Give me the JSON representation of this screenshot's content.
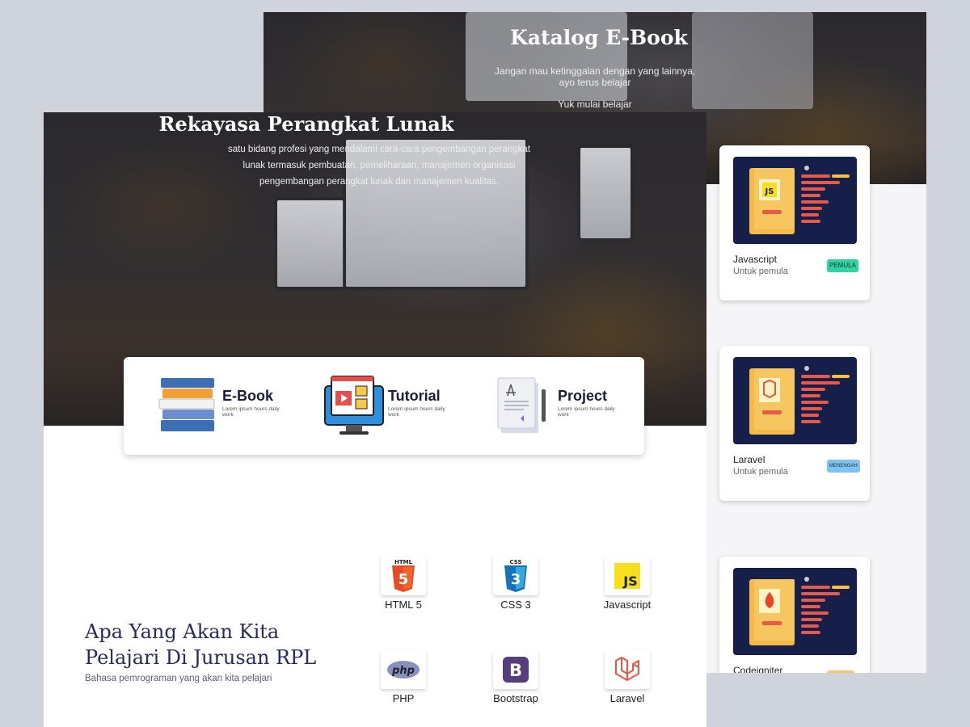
{
  "catalog": {
    "title": "Katalog E-Book",
    "subtitle_line1": "Jangan mau ketinggalan dengan yang lainnya,",
    "subtitle_line2": "ayo terus belajar",
    "cta": "Yuk mulai belajar",
    "books": [
      {
        "name": "Javascript",
        "desc": "Untuk pemula",
        "badge": "PEMULA",
        "badge_color": "#2fd3a6",
        "icon": "javascript-icon"
      },
      {
        "name": "Laravel",
        "desc": "Untuk pemula",
        "badge": "MENENGAH",
        "badge_color": "#7fc3f5",
        "icon": "laravel-icon"
      },
      {
        "name": "Codeigniter",
        "desc": "",
        "badge": "",
        "badge_color": "#f9c46b",
        "icon": "codeigniter-icon"
      }
    ]
  },
  "hero": {
    "title": "Rekayasa Perangkat Lunak",
    "description": "satu bidang profesi yang mendalami cara-cara pengembangan perangkat lunak termasuk pembuatan, pemeliharaan, manajemen organisasi pengembangan perangkat lunak dan manajemen kualitas."
  },
  "features": [
    {
      "title": "E-Book",
      "sub": "Lorem ipsum hours daily work",
      "icon": "books-icon"
    },
    {
      "title": "Tutorial",
      "sub": "Lorem ipsum hours daily work",
      "icon": "video-tutorial-icon"
    },
    {
      "title": "Project",
      "sub": "Lorem ipsum hours daily work",
      "icon": "document-project-icon"
    }
  ],
  "learn": {
    "title": "Apa Yang Akan Kita Pelajari Di Jurusan RPL",
    "subtitle": "Bahasa pemrograman yang akan kita pelajari",
    "techs": [
      {
        "name": "HTML 5",
        "icon": "html5-icon"
      },
      {
        "name": "CSS 3",
        "icon": "css3-icon"
      },
      {
        "name": "Javascript",
        "icon": "javascript-icon"
      },
      {
        "name": "PHP",
        "icon": "php-icon"
      },
      {
        "name": "Bootstrap",
        "icon": "bootstrap-icon"
      },
      {
        "name": "Laravel",
        "icon": "laravel-icon"
      }
    ]
  },
  "colors": {
    "navy": "#262a5c",
    "html": "#e44d26",
    "css": "#2965f1",
    "js": "#f7df1e",
    "php": "#8892bf",
    "bootstrap": "#563d7c",
    "laravel": "#f05340"
  }
}
